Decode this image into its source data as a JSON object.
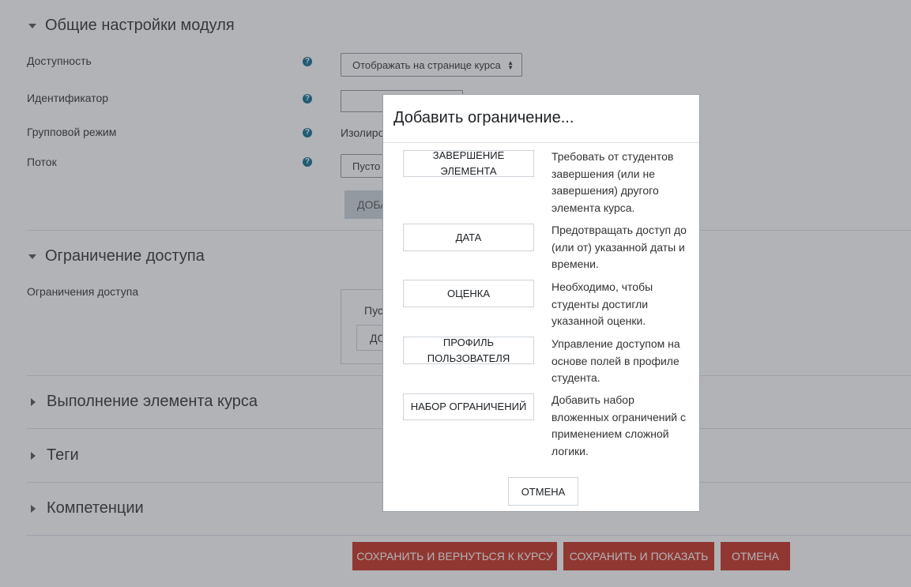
{
  "sections": {
    "general": "Общие настройки модуля",
    "access": "Ограничение доступа",
    "completion": "Выполнение элемента курса",
    "tags": "Теги",
    "competencies": "Компетенции"
  },
  "fields": {
    "availability": {
      "label": "Доступность",
      "value": "Отображать на странице курса"
    },
    "idnumber": {
      "label": "Идентификатор",
      "value": ""
    },
    "groupmode": {
      "label": "Групповой режим",
      "value": "Изолиро"
    },
    "grouping": {
      "label": "Поток",
      "value": "Пусто"
    },
    "add_grouping_btn": "ДОБА",
    "restrictions": {
      "label": "Ограничения доступа",
      "empty": "Пуст",
      "add_btn": "ДО"
    }
  },
  "help_icon_glyph": "?",
  "footer": {
    "save_return": "СОХРАНИТЬ И ВЕРНУТЬСЯ К КУРСУ",
    "save_display": "СОХРАНИТЬ И ПОКАЗАТЬ",
    "cancel": "ОТМЕНА"
  },
  "modal": {
    "title": "Добавить ограничение...",
    "options": [
      {
        "button": "ЗАВЕРШЕНИЕ ЭЛЕМЕНТА",
        "description": "Требовать от студентов завершения (или не завершения) другого элемента курса."
      },
      {
        "button": "ДАТА",
        "description": "Предотвращать доступ до (или от) указанной даты и времени."
      },
      {
        "button": "ОЦЕНКА",
        "description": "Необходимо, чтобы студенты достигли указанной оценки."
      },
      {
        "button": "ПРОФИЛЬ ПОЛЬЗОВАТЕЛЯ",
        "description": "Управление доступом на основе полей в профиле студента."
      },
      {
        "button": "НАБОР ОГРАНИЧЕНИЙ",
        "description": "Добавить набор вложенных ограничений с применением сложной логики."
      }
    ],
    "cancel": "ОТМЕНА"
  },
  "colors": {
    "primary_button": "#ca3120",
    "help_icon": "#0f6f8f",
    "overlay": "rgba(60,66,76,0.4)"
  }
}
